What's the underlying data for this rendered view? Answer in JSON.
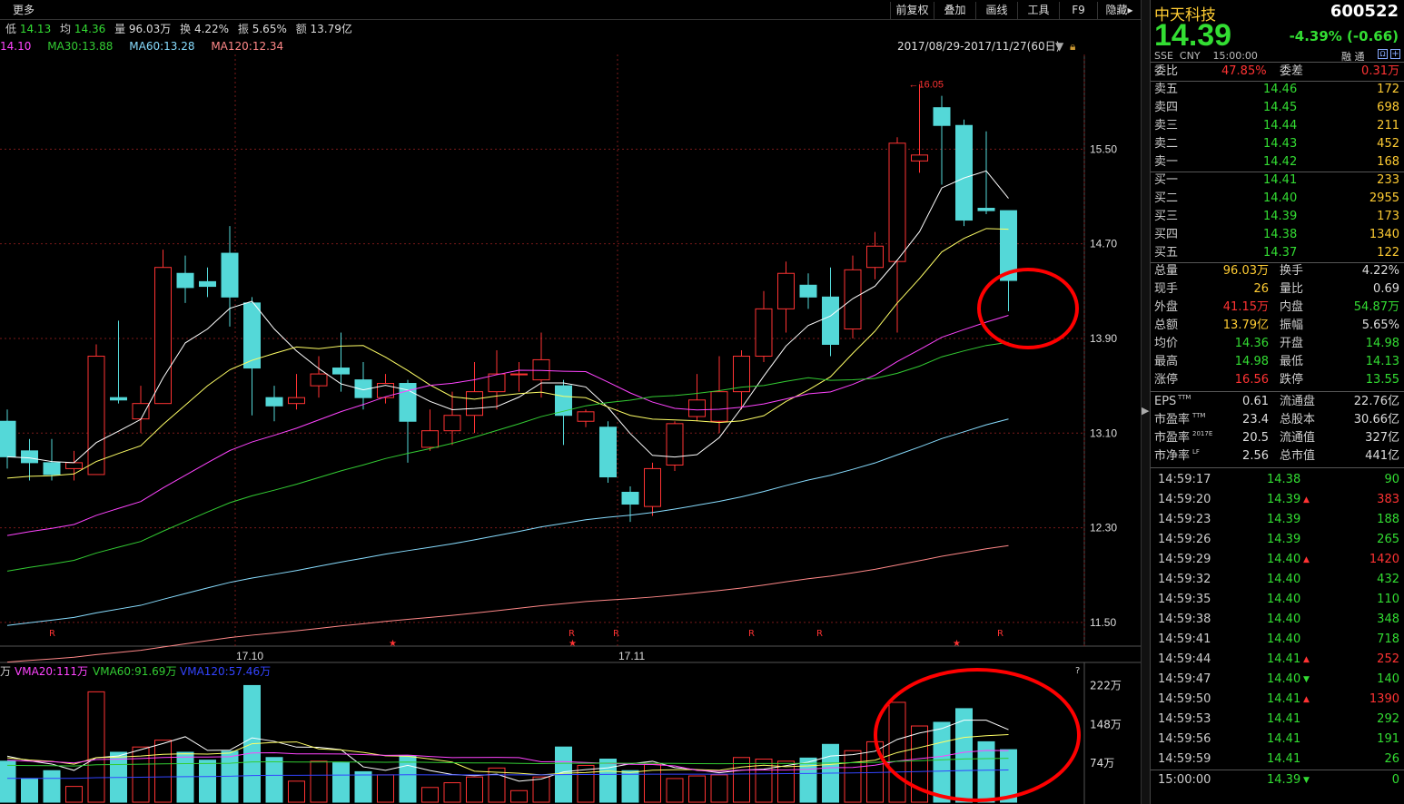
{
  "toolbar": {
    "more": "更多",
    "buttons": [
      "前复权",
      "叠加",
      "画线",
      "工具",
      "F9",
      "隐藏▸"
    ]
  },
  "infobar": {
    "low_label": "低",
    "low": "14.13",
    "avg_label": "均",
    "avg": "14.36",
    "vol_label": "量",
    "vol": "96.03万",
    "turn_label": "换",
    "turn": "4.22%",
    "amp_label": "振",
    "amp": "5.65%",
    "amt_label": "额",
    "amt": "13.79亿"
  },
  "ma_bar": {
    "ma10": "14.10",
    "ma30": "MA30:13.88",
    "ma60": "MA60:13.28",
    "ma120": "MA120:12.34",
    "range": "2017/08/29-2017/11/27(60日)"
  },
  "chart_data": {
    "type": "candlestick",
    "y_ticks": [
      "15.50",
      "14.70",
      "13.90",
      "13.10",
      "12.30",
      "11.50"
    ],
    "x_ticks": [
      "17.10",
      "17.11"
    ],
    "high_marker": "16.05",
    "markers": [
      "R",
      "R",
      "R",
      "R",
      "R",
      "R",
      "★",
      "★",
      "★"
    ],
    "volume_ticks": [
      "222万",
      "148万",
      "74万"
    ],
    "vma_labels": {
      "vma20": "VMA20:111万",
      "vma60": "VMA60:91.69万",
      "vma120": "VMA120:57.46万"
    },
    "candles": [
      {
        "o": 13.2,
        "c": 12.9,
        "h": 13.3,
        "l": 12.8
      },
      {
        "o": 12.95,
        "c": 12.85,
        "h": 13.05,
        "l": 12.7
      },
      {
        "o": 12.85,
        "c": 12.75,
        "h": 13.05,
        "l": 12.7
      },
      {
        "o": 12.8,
        "c": 12.85,
        "h": 12.95,
        "l": 12.7
      },
      {
        "o": 12.75,
        "c": 13.75,
        "h": 13.85,
        "l": 12.75
      },
      {
        "o": 13.4,
        "c": 13.38,
        "h": 14.05,
        "l": 13.35
      },
      {
        "o": 13.22,
        "c": 13.35,
        "h": 13.5,
        "l": 13.1
      },
      {
        "o": 13.35,
        "c": 14.5,
        "h": 14.65,
        "l": 13.35
      },
      {
        "o": 14.45,
        "c": 14.33,
        "h": 14.6,
        "l": 14.2
      },
      {
        "o": 14.38,
        "c": 14.34,
        "h": 14.5,
        "l": 14.25
      },
      {
        "o": 14.62,
        "c": 14.25,
        "h": 14.85,
        "l": 14.0
      },
      {
        "o": 14.2,
        "c": 13.65,
        "h": 14.25,
        "l": 13.25
      },
      {
        "o": 13.4,
        "c": 13.33,
        "h": 13.5,
        "l": 13.2
      },
      {
        "o": 13.35,
        "c": 13.4,
        "h": 13.6,
        "l": 13.3
      },
      {
        "o": 13.5,
        "c": 13.6,
        "h": 13.75,
        "l": 13.4
      },
      {
        "o": 13.65,
        "c": 13.6,
        "h": 13.95,
        "l": 13.45
      },
      {
        "o": 13.55,
        "c": 13.4,
        "h": 13.7,
        "l": 13.3
      },
      {
        "o": 13.4,
        "c": 13.52,
        "h": 13.6,
        "l": 13.35
      },
      {
        "o": 13.52,
        "c": 13.2,
        "h": 13.55,
        "l": 12.85
      },
      {
        "o": 12.98,
        "c": 13.12,
        "h": 13.3,
        "l": 12.95
      },
      {
        "o": 13.12,
        "c": 13.25,
        "h": 13.45,
        "l": 13.0
      },
      {
        "o": 13.25,
        "c": 13.45,
        "h": 13.7,
        "l": 13.1
      },
      {
        "o": 13.45,
        "c": 13.6,
        "h": 13.8,
        "l": 13.3
      },
      {
        "o": 13.6,
        "c": 13.6,
        "h": 13.7,
        "l": 13.45
      },
      {
        "o": 13.55,
        "c": 13.72,
        "h": 13.95,
        "l": 13.4
      },
      {
        "o": 13.5,
        "c": 13.25,
        "h": 13.55,
        "l": 13.0
      },
      {
        "o": 13.2,
        "c": 13.28,
        "h": 13.3,
        "l": 13.15
      },
      {
        "o": 13.15,
        "c": 12.73,
        "h": 13.2,
        "l": 12.68
      },
      {
        "o": 12.6,
        "c": 12.5,
        "h": 12.65,
        "l": 12.35
      },
      {
        "o": 12.48,
        "c": 12.8,
        "h": 12.85,
        "l": 12.4
      },
      {
        "o": 12.83,
        "c": 13.18,
        "h": 13.2,
        "l": 12.78
      },
      {
        "o": 13.24,
        "c": 13.38,
        "h": 13.6,
        "l": 13.2
      },
      {
        "o": 13.2,
        "c": 13.45,
        "h": 13.75,
        "l": 13.1
      },
      {
        "o": 13.45,
        "c": 13.75,
        "h": 13.8,
        "l": 13.3
      },
      {
        "o": 13.75,
        "c": 14.15,
        "h": 14.3,
        "l": 13.7
      },
      {
        "o": 14.15,
        "c": 14.45,
        "h": 14.55,
        "l": 13.95
      },
      {
        "o": 14.35,
        "c": 14.25,
        "h": 14.45,
        "l": 14.15
      },
      {
        "o": 14.25,
        "c": 13.85,
        "h": 14.5,
        "l": 13.75
      },
      {
        "o": 13.98,
        "c": 14.48,
        "h": 14.6,
        "l": 13.9
      },
      {
        "o": 14.5,
        "c": 14.68,
        "h": 14.8,
        "l": 14.4
      },
      {
        "o": 14.55,
        "c": 15.55,
        "h": 15.6,
        "l": 13.95
      },
      {
        "o": 15.4,
        "c": 15.45,
        "h": 16.05,
        "l": 15.3
      },
      {
        "o": 15.85,
        "c": 15.7,
        "h": 15.95,
        "l": 15.2
      },
      {
        "o": 15.7,
        "c": 14.9,
        "h": 15.75,
        "l": 14.85
      },
      {
        "o": 15.0,
        "c": 14.98,
        "h": 15.65,
        "l": 14.95
      },
      {
        "o": 14.98,
        "c": 14.39,
        "h": 14.98,
        "l": 14.13
      }
    ]
  },
  "quote": {
    "name": "中天科技",
    "code": "600522",
    "price": "14.39",
    "change": "-4.39% (-0.66)",
    "market": "SSE  CNY    15:00:00",
    "tags": "融 通",
    "wb_label": "委比",
    "wb": "47.85%",
    "wc_label": "委差",
    "wc": "0.31万",
    "asks": [
      {
        "label": "卖五",
        "price": "14.46",
        "vol": "172"
      },
      {
        "label": "卖四",
        "price": "14.45",
        "vol": "698"
      },
      {
        "label": "卖三",
        "price": "14.44",
        "vol": "211"
      },
      {
        "label": "卖二",
        "price": "14.43",
        "vol": "452"
      },
      {
        "label": "卖一",
        "price": "14.42",
        "vol": "168"
      }
    ],
    "bids": [
      {
        "label": "买一",
        "price": "14.41",
        "vol": "233"
      },
      {
        "label": "买二",
        "price": "14.40",
        "vol": "2955"
      },
      {
        "label": "买三",
        "price": "14.39",
        "vol": "173"
      },
      {
        "label": "买四",
        "price": "14.38",
        "vol": "1340"
      },
      {
        "label": "买五",
        "price": "14.37",
        "vol": "122"
      }
    ],
    "stats": [
      {
        "l1": "总量",
        "v1": "96.03万",
        "c1": "yellow",
        "l2": "换手",
        "v2": "4.22%",
        "c2": "white"
      },
      {
        "l1": "现手",
        "v1": "26",
        "c1": "yellow",
        "l2": "量比",
        "v2": "0.69",
        "c2": "white"
      },
      {
        "l1": "外盘",
        "v1": "41.15万",
        "c1": "red",
        "l2": "内盘",
        "v2": "54.87万",
        "c2": "green"
      },
      {
        "l1": "总额",
        "v1": "13.79亿",
        "c1": "yellow",
        "l2": "振幅",
        "v2": "5.65%",
        "c2": "white"
      },
      {
        "l1": "均价",
        "v1": "14.36",
        "c1": "green",
        "l2": "开盘",
        "v2": "14.98",
        "c2": "green"
      },
      {
        "l1": "最高",
        "v1": "14.98",
        "c1": "green",
        "l2": "最低",
        "v2": "14.13",
        "c2": "green"
      },
      {
        "l1": "涨停",
        "v1": "16.56",
        "c1": "red",
        "l2": "跌停",
        "v2": "13.55",
        "c2": "green"
      }
    ],
    "fund": [
      {
        "l1": "EPS",
        "s1": "TTM",
        "v1": "0.61",
        "l2": "流通盘",
        "v2": "22.76亿"
      },
      {
        "l1": "市盈率",
        "s1": "TTM",
        "v1": "23.4",
        "l2": "总股本",
        "v2": "30.66亿"
      },
      {
        "l1": "市盈率",
        "s1": "2017E",
        "v1": "20.5",
        "l2": "流通值",
        "v2": "327亿"
      },
      {
        "l1": "市净率",
        "s1": "LF",
        "v1": "2.56",
        "l2": "总市值",
        "v2": "441亿"
      }
    ],
    "ticks": [
      {
        "t": "14:59:17",
        "p": "14.38",
        "a": "",
        "v": "90",
        "vc": "green"
      },
      {
        "t": "14:59:20",
        "p": "14.39",
        "a": "up",
        "v": "383",
        "vc": "red"
      },
      {
        "t": "14:59:23",
        "p": "14.39",
        "a": "",
        "v": "188",
        "vc": "green"
      },
      {
        "t": "14:59:26",
        "p": "14.39",
        "a": "",
        "v": "265",
        "vc": "green"
      },
      {
        "t": "14:59:29",
        "p": "14.40",
        "a": "up",
        "v": "1420",
        "vc": "red"
      },
      {
        "t": "14:59:32",
        "p": "14.40",
        "a": "",
        "v": "432",
        "vc": "green"
      },
      {
        "t": "14:59:35",
        "p": "14.40",
        "a": "",
        "v": "110",
        "vc": "green"
      },
      {
        "t": "14:59:38",
        "p": "14.40",
        "a": "",
        "v": "348",
        "vc": "green"
      },
      {
        "t": "14:59:41",
        "p": "14.40",
        "a": "",
        "v": "718",
        "vc": "green"
      },
      {
        "t": "14:59:44",
        "p": "14.41",
        "a": "up",
        "v": "252",
        "vc": "red"
      },
      {
        "t": "14:59:47",
        "p": "14.40",
        "a": "down",
        "v": "140",
        "vc": "green"
      },
      {
        "t": "14:59:50",
        "p": "14.41",
        "a": "up",
        "v": "1390",
        "vc": "red"
      },
      {
        "t": "14:59:53",
        "p": "14.41",
        "a": "",
        "v": "292",
        "vc": "green"
      },
      {
        "t": "14:59:56",
        "p": "14.41",
        "a": "",
        "v": "191",
        "vc": "green"
      },
      {
        "t": "14:59:59",
        "p": "14.41",
        "a": "",
        "v": "26",
        "vc": "green"
      },
      {
        "t": "15:00:00",
        "p": "14.39",
        "a": "down",
        "v": "0",
        "vc": "green"
      }
    ]
  },
  "colors": {
    "up": "#ff3333",
    "down": "#54d8d8",
    "ma5": "#ffffff",
    "ma10": "#ffff66",
    "ma20": "#ff44ff",
    "ma30": "#33cc33",
    "ma60": "#88ddff",
    "ma120": "#ff8888",
    "circle": "#ff0000"
  }
}
